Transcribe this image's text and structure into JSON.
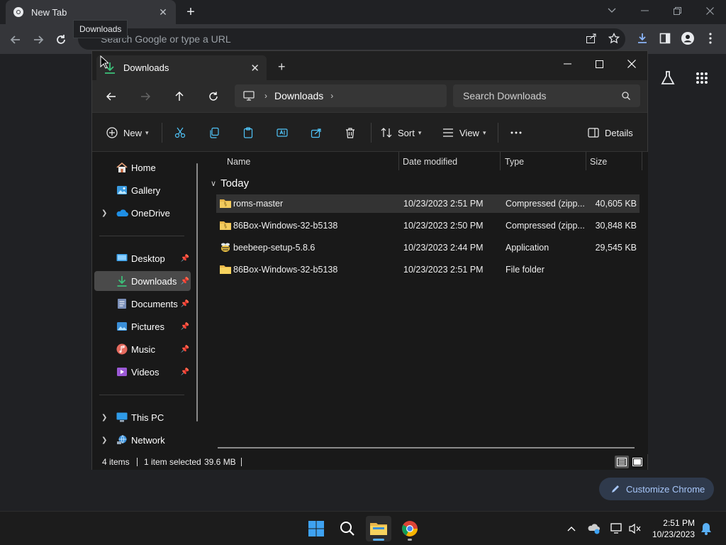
{
  "chrome": {
    "tab_title": "New Tab",
    "tooltip": "Downloads",
    "omnibox_placeholder": "Search Google or type a URL",
    "customize_label": "Customize Chrome"
  },
  "explorer": {
    "tab_title": "Downloads",
    "breadcrumb": [
      "Downloads"
    ],
    "search_placeholder": "Search Downloads",
    "commands": {
      "new": "New",
      "sort": "Sort",
      "view": "View",
      "details": "Details"
    },
    "sidebar": {
      "top": [
        {
          "label": "Home",
          "icon": "home-icon",
          "expander": false
        },
        {
          "label": "Gallery",
          "icon": "gallery-icon",
          "expander": false
        },
        {
          "label": "OneDrive",
          "icon": "cloud-icon",
          "expander": true
        }
      ],
      "pinned": [
        {
          "label": "Desktop",
          "icon": "desktop-icon"
        },
        {
          "label": "Downloads",
          "icon": "download-icon",
          "selected": true
        },
        {
          "label": "Documents",
          "icon": "documents-icon"
        },
        {
          "label": "Pictures",
          "icon": "pictures-icon"
        },
        {
          "label": "Music",
          "icon": "music-icon"
        },
        {
          "label": "Videos",
          "icon": "videos-icon"
        }
      ],
      "bottom": [
        {
          "label": "This PC",
          "icon": "computer-icon",
          "expander": true
        },
        {
          "label": "Network",
          "icon": "network-icon",
          "expander": true
        }
      ]
    },
    "columns": [
      "Name",
      "Date modified",
      "Type",
      "Size"
    ],
    "group": "Today",
    "files": [
      {
        "name": "roms-master",
        "date": "10/23/2023 2:51 PM",
        "type": "Compressed (zipp...",
        "size": "40,605 KB",
        "icon": "zip-folder-icon",
        "selected": true
      },
      {
        "name": "86Box-Windows-32-b5138",
        "date": "10/23/2023 2:50 PM",
        "type": "Compressed (zipp...",
        "size": "30,848 KB",
        "icon": "zip-folder-icon"
      },
      {
        "name": "beebeep-setup-5.8.6",
        "date": "10/23/2023 2:44 PM",
        "type": "Application",
        "size": "29,545 KB",
        "icon": "app-icon"
      },
      {
        "name": "86Box-Windows-32-b5138",
        "date": "10/23/2023 2:51 PM",
        "type": "File folder",
        "size": "",
        "icon": "folder-icon"
      }
    ],
    "status": {
      "items": "4 items",
      "selected": "1 item selected",
      "size": "39.6 MB"
    }
  },
  "taskbar": {
    "time": "2:51 PM",
    "date": "10/23/2023"
  }
}
